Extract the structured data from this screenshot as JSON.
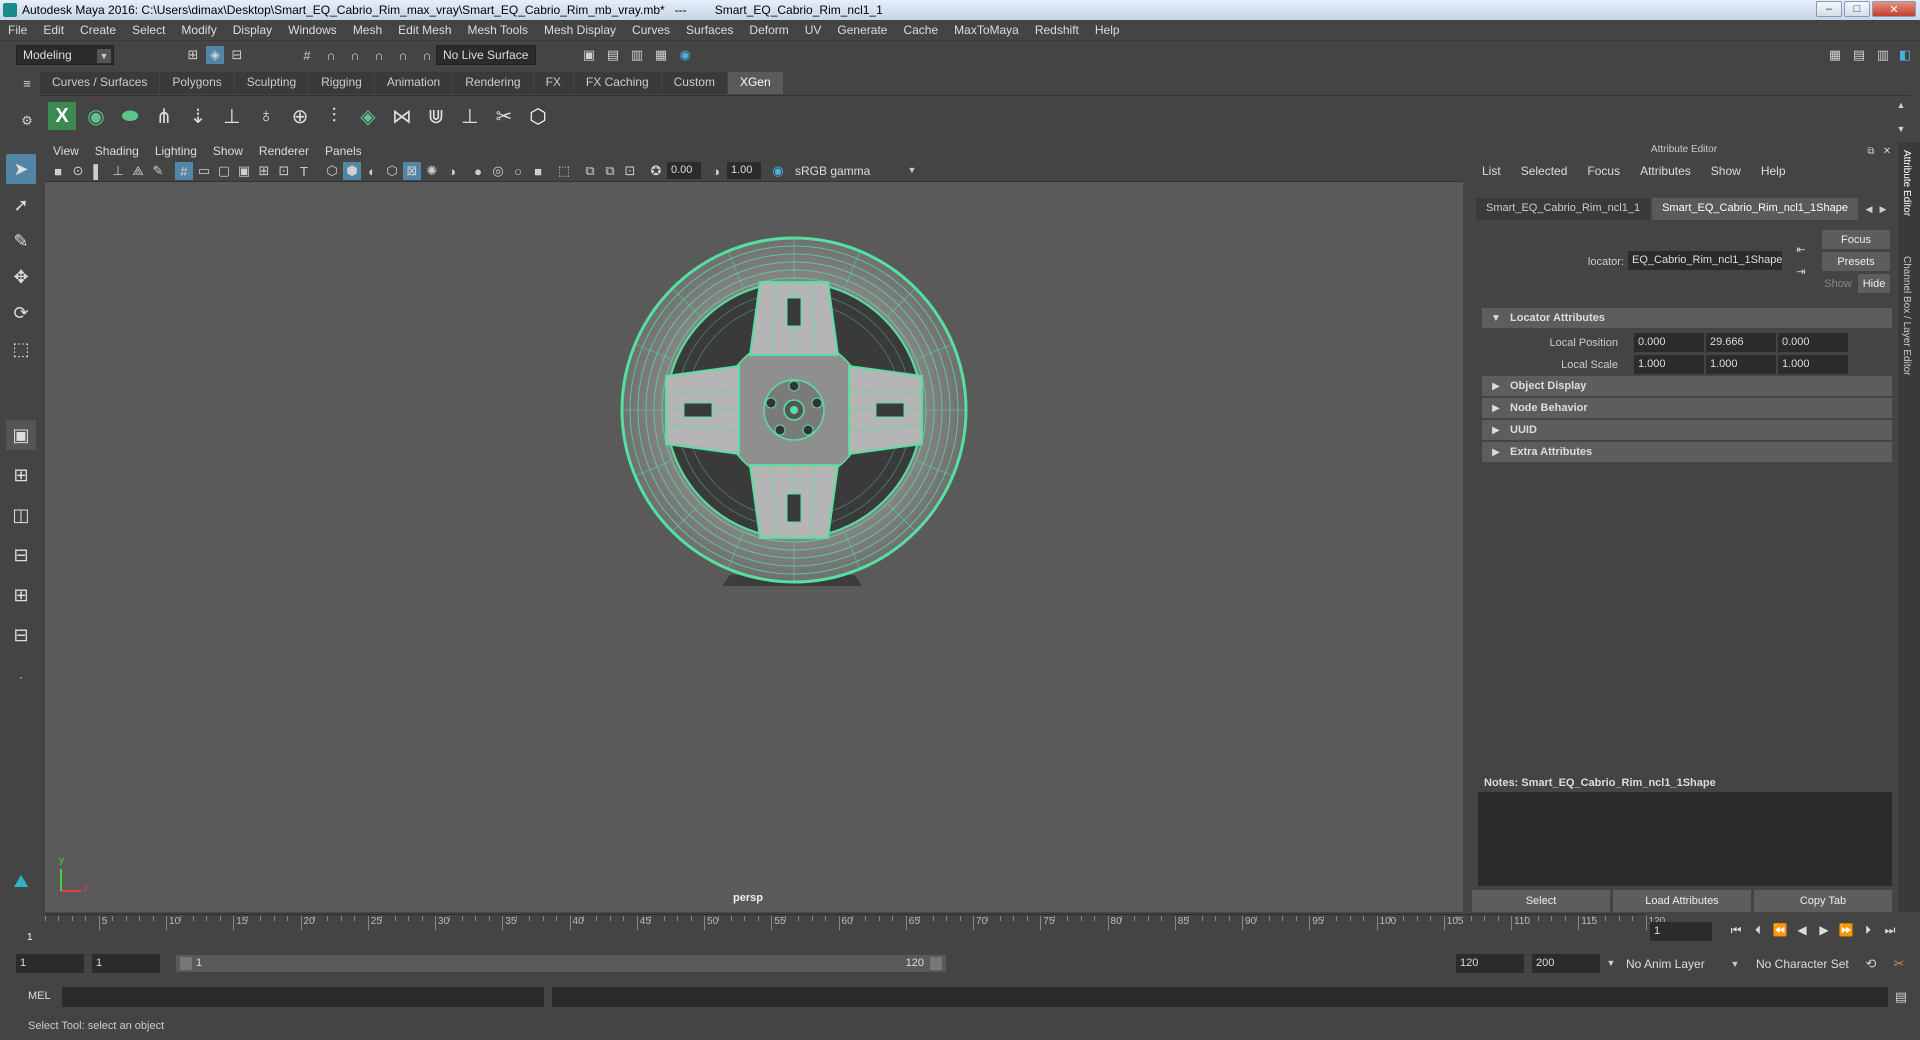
{
  "window": {
    "title": "Autodesk Maya 2016: C:\\Users\\dimax\\Desktop\\Smart_EQ_Cabrio_Rim_max_vray\\Smart_EQ_Cabrio_Rim_mb_vray.mb*   ---",
    "title_object": "Smart_EQ_Cabrio_Rim_ncl1_1",
    "minimize": "‒",
    "maximize": "□",
    "close": "✕"
  },
  "menubar": [
    "File",
    "Edit",
    "Create",
    "Select",
    "Modify",
    "Display",
    "Windows",
    "Mesh",
    "Edit Mesh",
    "Mesh Tools",
    "Mesh Display",
    "Curves",
    "Surfaces",
    "Deform",
    "UV",
    "Generate",
    "Cache",
    "MaxToMaya",
    "Redshift",
    "Help"
  ],
  "status_line": {
    "mode": "Modeling",
    "live_surface": "No Live Surface"
  },
  "shelf": {
    "tabs": [
      "Curves / Surfaces",
      "Polygons",
      "Sculpting",
      "Rigging",
      "Animation",
      "Rendering",
      "FX",
      "FX Caching",
      "Custom",
      "XGen"
    ],
    "active_tab": "XGen"
  },
  "viewport": {
    "menu": [
      "View",
      "Shading",
      "Lighting",
      "Show",
      "Renderer",
      "Panels"
    ],
    "exposure": "0.00",
    "gamma": "1.00",
    "color_space": "sRGB gamma",
    "camera": "persp",
    "axis_y": "y",
    "axis_x": "x"
  },
  "attribute_editor": {
    "title": "Attribute Editor",
    "menu": [
      "List",
      "Selected",
      "Focus",
      "Attributes",
      "Show",
      "Help"
    ],
    "tabs": [
      "Smart_EQ_Cabrio_Rim_ncl1_1",
      "Smart_EQ_Cabrio_Rim_ncl1_1Shape"
    ],
    "active_tab": "Smart_EQ_Cabrio_Rim_ncl1_1Shape",
    "node_type_label": "locator:",
    "node_name": "EQ_Cabrio_Rim_ncl1_1Shape",
    "focus_btn": "Focus",
    "presets_btn": "Presets",
    "show_btn": "Show",
    "hide_btn": "Hide",
    "sections": {
      "locator": "Locator Attributes",
      "object_display": "Object Display",
      "node_behavior": "Node Behavior",
      "uuid": "UUID",
      "extra": "Extra Attributes"
    },
    "local_position_label": "Local Position",
    "local_position": [
      "0.000",
      "29.666",
      "0.000"
    ],
    "local_scale_label": "Local Scale",
    "local_scale": [
      "1.000",
      "1.000",
      "1.000"
    ],
    "notes_label": "Notes:  Smart_EQ_Cabrio_Rim_ncl1_1Shape",
    "bottom_buttons": [
      "Select",
      "Load Attributes",
      "Copy Tab"
    ]
  },
  "side_tabs": [
    "Attribute Editor",
    "Channel Box / Layer Editor"
  ],
  "time_slider": {
    "ticks": [
      "5",
      "10",
      "15",
      "20",
      "25",
      "30",
      "35",
      "40",
      "45",
      "50",
      "55",
      "60",
      "65",
      "70",
      "75",
      "80",
      "85",
      "90",
      "95",
      "100",
      "105",
      "110",
      "115",
      "120"
    ],
    "current_frame_marker": "1",
    "current_frame": "1"
  },
  "range_slider": {
    "start": "1",
    "playback_start": "1",
    "slider_start": "1",
    "slider_end": "120",
    "playback_end": "120",
    "end": "200",
    "anim_layer": "No Anim Layer",
    "character_set": "No Character Set"
  },
  "command_line": {
    "label": "MEL"
  },
  "help_line": {
    "text": "Select Tool: select an object"
  },
  "colors": {
    "wireframe": "#55e0a0",
    "active_tab": "#5285a6",
    "viewport_bg": "#5a5a5a"
  }
}
